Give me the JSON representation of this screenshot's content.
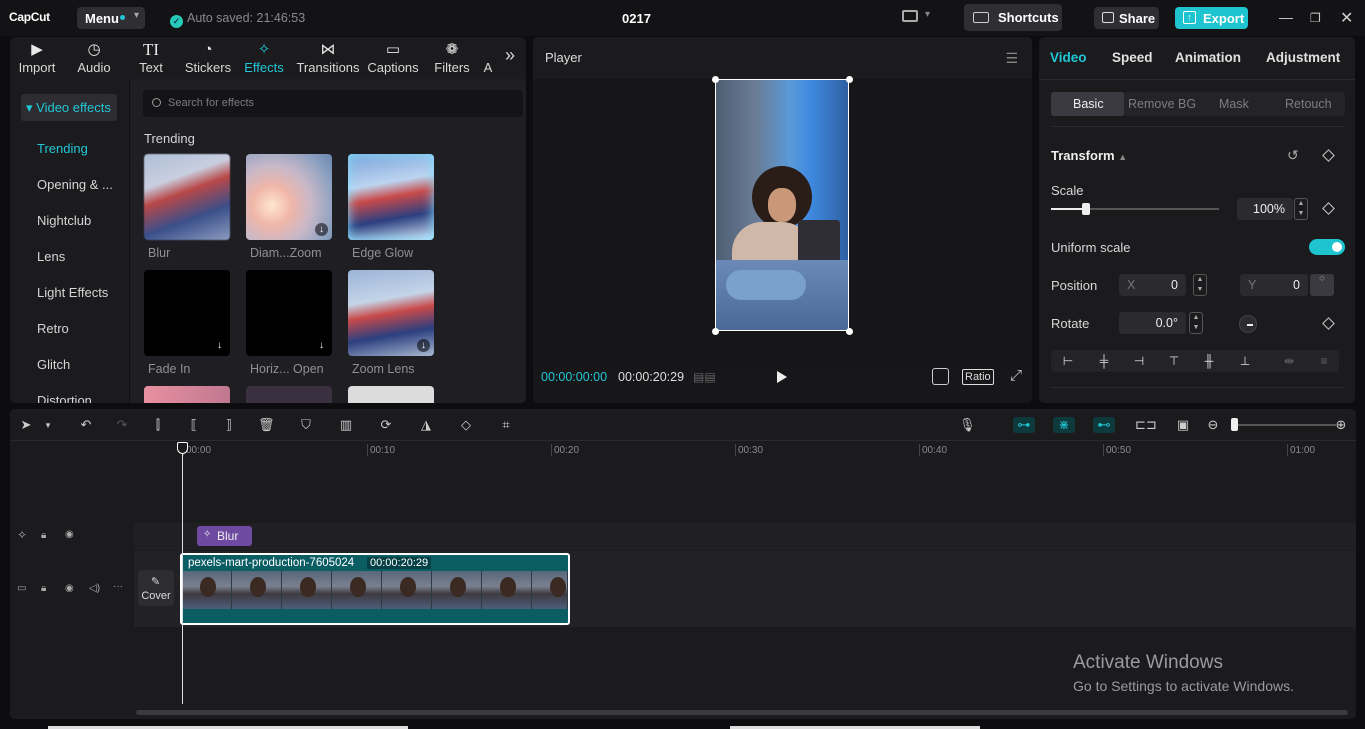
{
  "app": {
    "logo": "CapCut",
    "menu_label": "Menu",
    "saved_text": "Auto saved: 21:46:53",
    "project_title": "0217"
  },
  "header": {
    "shortcuts_label": "Shortcuts",
    "share_label": "Share",
    "export_label": "Export"
  },
  "tools": [
    {
      "label": "Import",
      "icon": "import-icon"
    },
    {
      "label": "Audio",
      "icon": "audio-icon"
    },
    {
      "label": "Text",
      "icon": "text-icon"
    },
    {
      "label": "Stickers",
      "icon": "stickers-icon"
    },
    {
      "label": "Effects",
      "icon": "effects-icon"
    },
    {
      "label": "Transitions",
      "icon": "transitions-icon"
    },
    {
      "label": "Captions",
      "icon": "captions-icon"
    },
    {
      "label": "Filters",
      "icon": "filters-icon"
    },
    {
      "label": "A",
      "icon": ""
    }
  ],
  "sidebar": {
    "head": "Video effects",
    "items": [
      "Trending",
      "Opening & ...",
      "Nightclub",
      "Lens",
      "Light Effects",
      "Retro",
      "Glitch",
      "Distortion"
    ]
  },
  "effects": {
    "search_placeholder": "Search for effects",
    "section": "Trending",
    "tiles": [
      "Blur",
      "Diam...Zoom",
      "Edge Glow",
      "Fade In",
      "Horiz... Open",
      "Zoom Lens"
    ]
  },
  "player": {
    "title": "Player",
    "current_time": "00:00:00:00",
    "total_time": "00:00:20:29",
    "ratio_label": "Ratio"
  },
  "props": {
    "tabs": [
      "Video",
      "Speed",
      "Animation",
      "Adjustment"
    ],
    "subtabs": [
      "Basic",
      "Remove BG",
      "Mask",
      "Retouch"
    ],
    "section": "Transform",
    "scale_label": "Scale",
    "scale_value": "100%",
    "scale_fraction": 0.21,
    "uniform_label": "Uniform scale",
    "position_label": "Position",
    "pos_x_axis": "X",
    "pos_x": "0",
    "pos_y_axis": "Y",
    "pos_y": "0",
    "rotate_label": "Rotate",
    "rotate_value": "0.0°"
  },
  "timeline": {
    "ruler": [
      "00:00",
      "00:10",
      "00:20",
      "00:30",
      "00:40",
      "00:50",
      "01:00"
    ],
    "fx_clip": "Blur",
    "video_clip_name": "pexels-mart-production-7605024",
    "video_clip_duration": "00:00:20:29",
    "cover_label": "Cover"
  },
  "os": {
    "activate_title": "Activate Windows",
    "activate_sub": "Go to Settings to activate Windows."
  },
  "colors": {
    "accent": "#22c7d6",
    "fx_clip": "#6e4aa0",
    "video_clip": "#0b5d64"
  }
}
